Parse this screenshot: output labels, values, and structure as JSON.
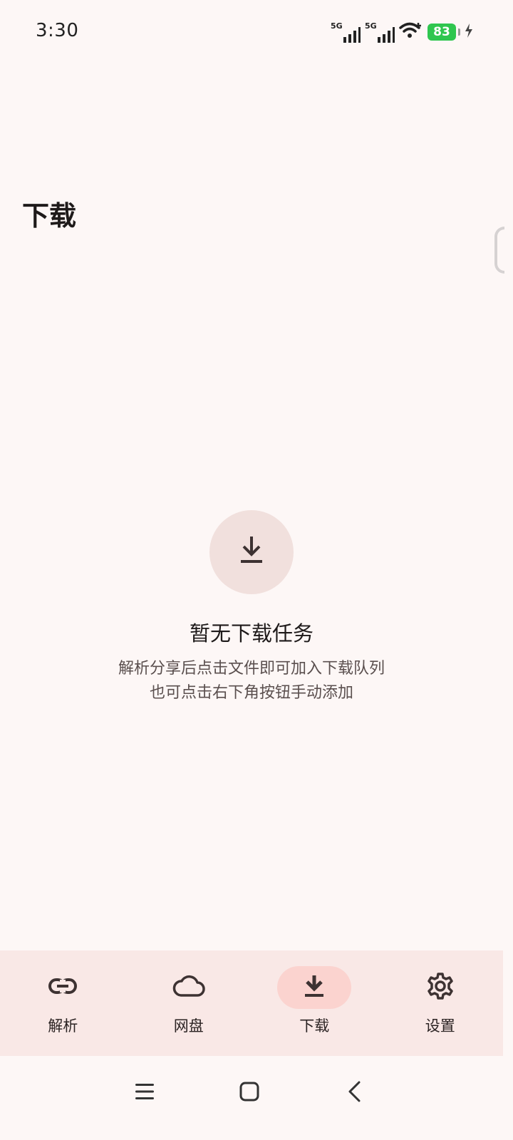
{
  "status_bar": {
    "time": "3:30",
    "network_1": "5G",
    "network_2": "5G",
    "battery": "83"
  },
  "header": {
    "title": "下载"
  },
  "empty_state": {
    "icon": "download-icon",
    "title": "暂无下载任务",
    "line1": "解析分享后点击文件即可加入下载队列",
    "line2": "也可点击右下角按钮手动添加"
  },
  "bottom_nav": {
    "items": [
      {
        "label": "解析",
        "icon": "link-icon",
        "active": false
      },
      {
        "label": "网盘",
        "icon": "cloud-icon",
        "active": false
      },
      {
        "label": "下载",
        "icon": "download-icon",
        "active": true
      },
      {
        "label": "设置",
        "icon": "gear-icon",
        "active": false
      }
    ]
  },
  "colors": {
    "background": "#fdf7f6",
    "nav_background": "#f9e8e6",
    "active_pill": "#fbd3cf",
    "icon": "#3d3232",
    "battery": "#2fc64f"
  }
}
